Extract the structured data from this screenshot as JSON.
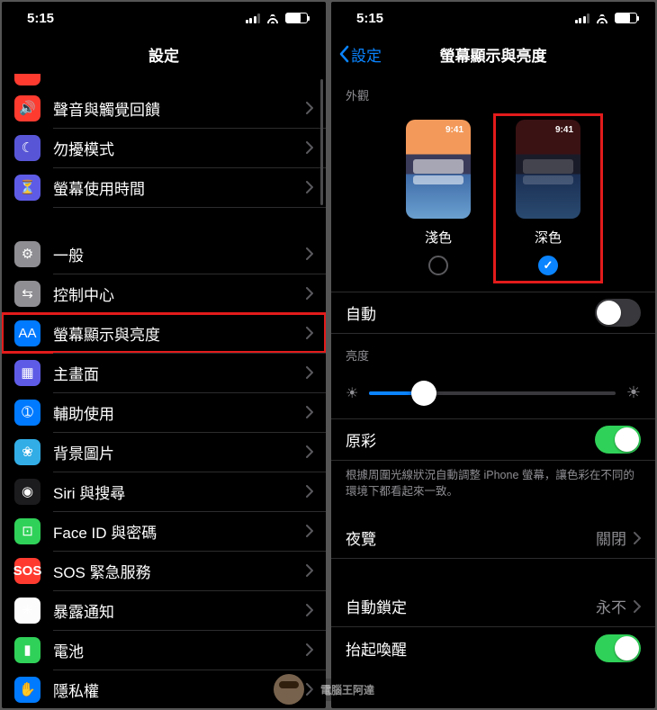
{
  "status": {
    "time": "5:15"
  },
  "left": {
    "title": "設定",
    "rows": [
      {
        "label": "聲音與觸覺回饋",
        "icon": "sound-icon",
        "bg": "bg-red"
      },
      {
        "label": "勿擾模式",
        "icon": "moon-icon",
        "bg": "bg-purple"
      },
      {
        "label": "螢幕使用時間",
        "icon": "hourglass-icon",
        "bg": "bg-indigo"
      }
    ],
    "rows2": [
      {
        "label": "一般",
        "icon": "gear-icon",
        "bg": "bg-gray"
      },
      {
        "label": "控制中心",
        "icon": "switches-icon",
        "bg": "bg-gray"
      },
      {
        "label": "螢幕顯示與亮度",
        "icon": "textsize-icon",
        "bg": "bg-blue",
        "hl": true
      },
      {
        "label": "主畫面",
        "icon": "grid-icon",
        "bg": "bg-indigo"
      },
      {
        "label": "輔助使用",
        "icon": "accessibility-icon",
        "bg": "bg-blue"
      },
      {
        "label": "背景圖片",
        "icon": "flower-icon",
        "bg": "bg-cyan"
      },
      {
        "label": "Siri 與搜尋",
        "icon": "siri-icon",
        "bg": "bg-black"
      },
      {
        "label": "Face ID 與密碼",
        "icon": "faceid-icon",
        "bg": "bg-green"
      },
      {
        "label": "SOS 緊急服務",
        "icon": "sos-icon",
        "bg": "bg-sos",
        "text_icon": "SOS"
      },
      {
        "label": "暴露通知",
        "icon": "exposure-icon",
        "bg": "bg-white"
      },
      {
        "label": "電池",
        "icon": "battery-icon",
        "bg": "bg-batt"
      },
      {
        "label": "隱私權",
        "icon": "hand-icon",
        "bg": "bg-blue"
      }
    ]
  },
  "right": {
    "back": "設定",
    "title": "螢幕顯示與亮度",
    "appearance_header": "外觀",
    "light_label": "淺色",
    "dark_label": "深色",
    "thumb_time": "9:41",
    "auto_label": "自動",
    "auto_on": false,
    "brightness_header": "亮度",
    "truetone_label": "原彩",
    "truetone_on": true,
    "truetone_note": "根據周圍光線狀況自動調整 iPhone 螢幕，讓色彩在不同的環境下都看起來一致。",
    "night_label": "夜覽",
    "night_value": "關閉",
    "autolock_label": "自動鎖定",
    "autolock_value": "永不",
    "raise_label": "抬起喚醒",
    "raise_on": true
  },
  "watermark": "電腦王阿達"
}
